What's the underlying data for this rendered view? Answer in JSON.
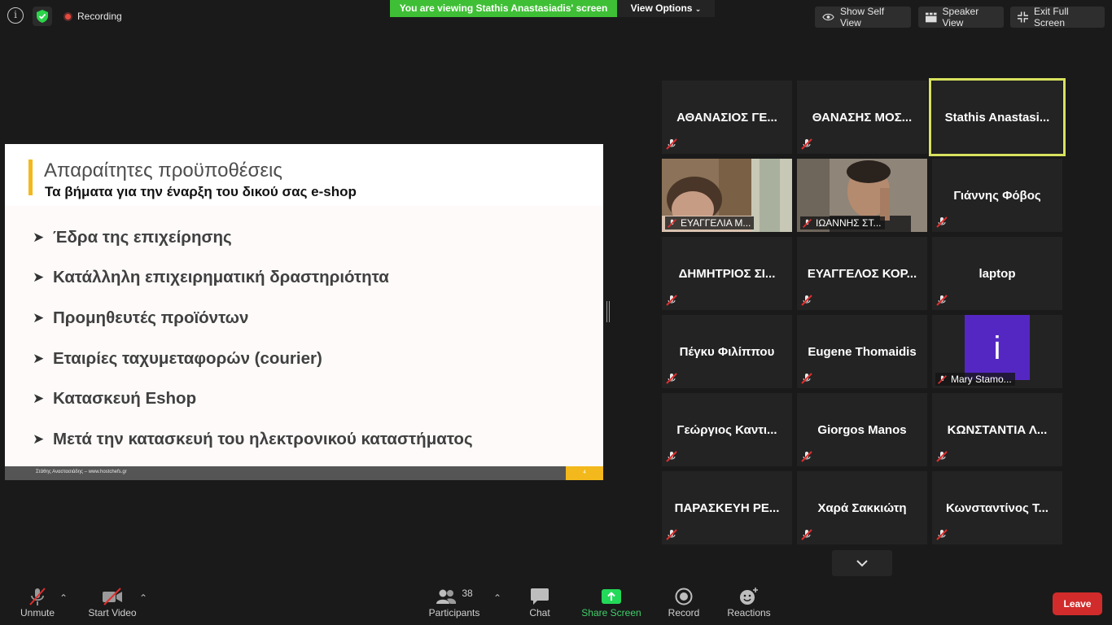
{
  "top_bar": {
    "recording_label": "Recording",
    "viewing_banner": "You are viewing Stathis Anastasiadis' screen",
    "view_options_label": "View Options",
    "show_self_view_label": "Show Self View",
    "speaker_view_label": "Speaker View",
    "exit_full_screen_label": "Exit Full Screen"
  },
  "shared_slide": {
    "title": "Απαραίτητες προϋποθέσεις",
    "subtitle": "Τα βήματα για την έναρξη του δικού σας e-shop",
    "bullets": [
      "Έδρα της επιχείρησης",
      "Κατάλληλη επιχειρηματική δραστηριότητα",
      "Προμηθευτές προϊόντων",
      "Εταιρίες ταχυμεταφορών (courier)",
      "Κατασκευή Eshop",
      "Μετά την κατασκευή του ηλεκτρονικού καταστήματος"
    ],
    "footer_text": "Στάθης Αναστασιάδης – www.hostchefs.gr",
    "page_number": "4"
  },
  "gallery": {
    "participants": [
      {
        "name": "ΑΘΑΝΑΣΙΟΣ ΓΕ...",
        "video": false,
        "muted": true
      },
      {
        "name": "ΘΑΝΑΣΗΣ ΜΟΣ...",
        "video": false,
        "muted": true
      },
      {
        "name": "Stathis Anastasi...",
        "video": false,
        "muted": false,
        "active_speaker": true
      },
      {
        "name": "ΕΥΑΓΓΕΛΙΑ Μ...",
        "video": true,
        "muted": true
      },
      {
        "name": "ΙΩΑΝΝΗΣ ΣΤ...",
        "video": true,
        "muted": true
      },
      {
        "name": "Γιάννης Φόβος",
        "video": false,
        "muted": true
      },
      {
        "name": "ΔΗΜΗΤΡΙΟΣ ΣΙ...",
        "video": false,
        "muted": true
      },
      {
        "name": "ΕΥΑΓΓΕΛΟΣ ΚΟΡ...",
        "video": false,
        "muted": true
      },
      {
        "name": "laptop",
        "video": false,
        "muted": true
      },
      {
        "name": "Πέγκυ Φιλίππου",
        "video": false,
        "muted": true
      },
      {
        "name": "Eugene Thomaidis",
        "video": false,
        "muted": true
      },
      {
        "name": "Mary Stamo...",
        "video": false,
        "muted": true,
        "avatar_letter": "i"
      },
      {
        "name": "Γεώργιος Καντι...",
        "video": false,
        "muted": true
      },
      {
        "name": "Giorgos Manos",
        "video": false,
        "muted": true
      },
      {
        "name": "ΚΩΝΣΤΑΝΤΙΑ Λ...",
        "video": false,
        "muted": true
      },
      {
        "name": "ΠΑΡΑΣΚΕΥΗ ΡΕ...",
        "video": false,
        "muted": true
      },
      {
        "name": "Χαρά Σακκιώτη",
        "video": false,
        "muted": true
      },
      {
        "name": "Κωνσταντίνος Τ...",
        "video": false,
        "muted": true
      }
    ]
  },
  "toolbar": {
    "unmute_label": "Unmute",
    "start_video_label": "Start Video",
    "participants_label": "Participants",
    "participants_count": "38",
    "chat_label": "Chat",
    "share_screen_label": "Share Screen",
    "record_label": "Record",
    "reactions_label": "Reactions",
    "leave_label": "Leave"
  },
  "colors": {
    "background": "#1a1a1a",
    "banner_green": "#3fbf36",
    "share_green": "#23d959",
    "leave_red": "#d12b2b",
    "active_speaker_border": "#d8e25e",
    "slide_accent": "#f3b81b",
    "avatar_purple": "#5527c2"
  },
  "icons": [
    "info-icon",
    "encryption-shield-icon",
    "recording-dot-icon",
    "eye-icon",
    "speaker-view-icon",
    "exit-full-screen-icon",
    "muted-mic-icon",
    "video-off-icon",
    "participants-icon",
    "chat-icon",
    "share-screen-icon",
    "record-icon",
    "reactions-icon",
    "chevron-down-icon"
  ]
}
